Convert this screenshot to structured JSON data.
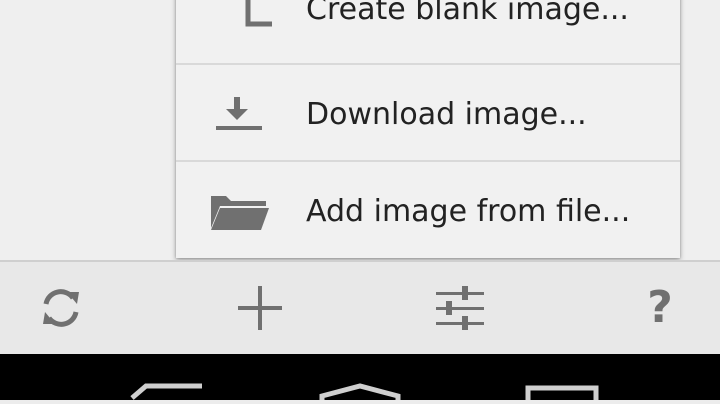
{
  "menu": {
    "items": [
      {
        "label": "Create blank image...",
        "icon": "blank-page-icon"
      },
      {
        "label": "Download image...",
        "icon": "download-icon"
      },
      {
        "label": "Add image from file...",
        "icon": "folder-icon"
      }
    ]
  },
  "toolbar": {
    "buttons": [
      {
        "name": "refresh",
        "icon": "refresh-icon"
      },
      {
        "name": "add",
        "icon": "plus-icon"
      },
      {
        "name": "settings",
        "icon": "sliders-icon"
      },
      {
        "name": "help",
        "icon": "help-icon",
        "glyph": "?"
      }
    ]
  },
  "navbar": {
    "buttons": [
      {
        "name": "back",
        "icon": "back-icon"
      },
      {
        "name": "home",
        "icon": "home-icon"
      },
      {
        "name": "recents",
        "icon": "recent-apps-icon"
      }
    ]
  },
  "colors": {
    "background": "#efefef",
    "menu_background": "#f1f1f1",
    "icon_gray": "#707070",
    "text": "#222222",
    "navbar": "#000000"
  }
}
